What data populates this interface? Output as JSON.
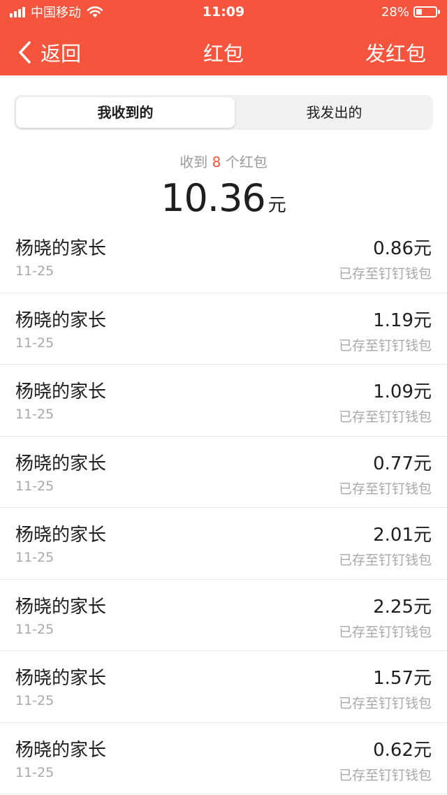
{
  "status_bar": {
    "carrier": "中国移动",
    "time": "11:09",
    "battery": "28%"
  },
  "nav": {
    "back_label": "返回",
    "title": "红包",
    "action_label": "发红包"
  },
  "tabs": [
    {
      "label": "我收到的",
      "active": true
    },
    {
      "label": "我发出的",
      "active": false
    }
  ],
  "summary": {
    "prefix": "收到",
    "count": "8",
    "suffix": "个红包",
    "total": "10.36",
    "unit": "元"
  },
  "list": [
    {
      "name": "杨晓的家长",
      "date": "11-25",
      "amount": "0.86元",
      "status": "已存至钉钉钱包"
    },
    {
      "name": "杨晓的家长",
      "date": "11-25",
      "amount": "1.19元",
      "status": "已存至钉钉钱包"
    },
    {
      "name": "杨晓的家长",
      "date": "11-25",
      "amount": "1.09元",
      "status": "已存至钉钉钱包"
    },
    {
      "name": "杨晓的家长",
      "date": "11-25",
      "amount": "0.77元",
      "status": "已存至钉钉钱包"
    },
    {
      "name": "杨晓的家长",
      "date": "11-25",
      "amount": "2.01元",
      "status": "已存至钉钉钱包"
    },
    {
      "name": "杨晓的家长",
      "date": "11-25",
      "amount": "2.25元",
      "status": "已存至钉钉钱包"
    },
    {
      "name": "杨晓的家长",
      "date": "11-25",
      "amount": "1.57元",
      "status": "已存至钉钉钱包"
    },
    {
      "name": "杨晓的家长",
      "date": "11-25",
      "amount": "0.62元",
      "status": "已存至钉钉钱包"
    }
  ],
  "colors": {
    "accent": "#f5553d",
    "text": "#1e1e1e",
    "muted": "#a8a8a8"
  }
}
